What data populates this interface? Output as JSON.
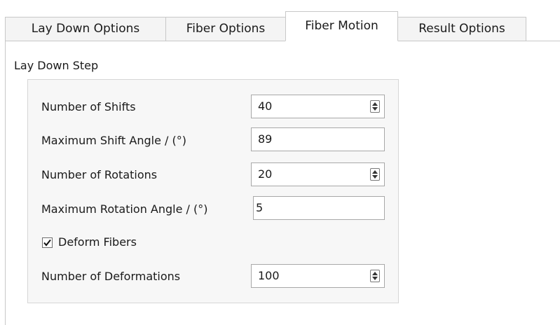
{
  "tabs": [
    {
      "label": "Lay Down Options",
      "active": false
    },
    {
      "label": "Fiber Options",
      "active": false
    },
    {
      "label": "Fiber Motion",
      "active": true
    },
    {
      "label": "Result Options",
      "active": false
    }
  ],
  "section": {
    "title": "Lay Down Step"
  },
  "fields": {
    "num_shifts": {
      "label": "Number of Shifts",
      "value": "40"
    },
    "max_shift_angle": {
      "label": "Maximum Shift Angle / (°)",
      "value": "89"
    },
    "num_rotations": {
      "label": "Number of Rotations",
      "value": "20"
    },
    "max_rotation_angle": {
      "label": "Maximum Rotation Angle / (°)",
      "value": "5"
    },
    "num_deformations": {
      "label": "Number of Deformations",
      "value": "100"
    }
  },
  "deform_fibers": {
    "label": "Deform Fibers",
    "checked": true
  }
}
